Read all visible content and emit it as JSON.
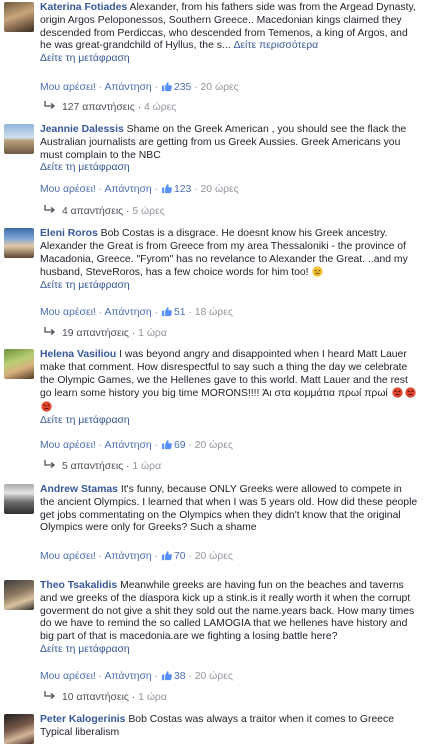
{
  "comments": [
    {
      "author": "Katerina Fotiades",
      "text": "Alexander, from his fathers side was from the Argead Dynasty, origin Argos Peloponessos, Southern Greece.. Macedonian kings claimed they descended from Perdiccas, who descended from Temenos, a king of Argos, and he was great-grandchild of Hyllus, the s...",
      "see_more": "Δείτε περισσότερα",
      "translate": "Δείτε τη μετάφραση",
      "like": "Μου αρέσει!",
      "reply": "Απάντηση",
      "likes": "235",
      "time": "20 ώρες",
      "replies": "127 απαντήσεις",
      "replies_time": "4 ώρες"
    },
    {
      "author": "Jeannie Dalessis",
      "text": "Shame on the Greek American , you should see the flack the Australian journalists are getting from us Greek Aussies. Greek Americans you must complain to the NBC",
      "translate": "Δείτε τη μετάφραση",
      "like": "Μου αρέσει!",
      "reply": "Απάντηση",
      "likes": "123",
      "time": "20 ώρες",
      "replies": "4 απαντήσεις",
      "replies_time": "5 ώρες"
    },
    {
      "author": "Eleni Roros",
      "text": "Bob Costas is a disgrace. He doesnt know his Greek ancestry. Alexander the Great is from Greece from my area Thessaloniki - the province of Macadonia, Greece. \"Fyrom\" has no revelance to Alexander the Great. ..and my husband, SteveRoros, has a few choice words for him too!",
      "translate": "Δείτε τη μετάφραση",
      "like": "Μου αρέσει!",
      "reply": "Απάντηση",
      "likes": "51",
      "time": "18 ώρες",
      "replies": "19 απαντήσεις",
      "replies_time": "1 ώρα"
    },
    {
      "author": "Helena Vasiliou",
      "text": "I was beyond angry and disappointed when I heard Matt Lauer make that comment. How disrespectful to say such a thing the day we celebrate the Olympic Games, we the Hellenes gave to this world. Matt Lauer and the rest go learn some history you big time MORONS!!!! Άι στα κομμάτια πρωί πρωί",
      "translate": "Δείτε τη μετάφραση",
      "like": "Μου αρέσει!",
      "reply": "Απάντηση",
      "likes": "69",
      "time": "20 ώρες",
      "replies": "5 απαντήσεις",
      "replies_time": "1 ώρα"
    },
    {
      "author": "Andrew Stamas",
      "text": "It's funny, because ONLY Greeks were allowed to compete in the ancient Olympics. I learned that when I was 5 years old. How did these people get jobs commentating on the Olympics when they didn't know that the original Olympics were only for Greeks? Such a shame",
      "like": "Μου αρέσει!",
      "reply": "Απάντηση",
      "likes": "70",
      "time": "20 ώρες",
      "replies": "3 απαντήσεις",
      "replies_time": "17 ώρες"
    },
    {
      "author": "Theo Tsakalidis",
      "text": "Meanwhile greeks are having fun on the beaches and taverns and we greeks of the diaspora kick up a stink.is it really worth it when the corrupt goverment do not give a shit they sold out the name.years back. How many times do we have to remind the so called LAMOGIA that we hellenes have history and big part of that is macedonia.are we fighting a losing battle here?",
      "translate": "Δείτε τη μετάφραση",
      "like": "Μου αρέσει!",
      "reply": "Απάντηση",
      "likes": "38",
      "time": "20 ώρες",
      "replies": "10 απαντήσεις",
      "replies_time": "1 ώρα"
    },
    {
      "author": "Peter Kalogerinis",
      "text": "Bob Costas was always a traitor when it comes to Greece Typical liberalism"
    }
  ],
  "colors": {
    "link": "#365899",
    "muted": "#90949c",
    "text": "#1d2129"
  }
}
